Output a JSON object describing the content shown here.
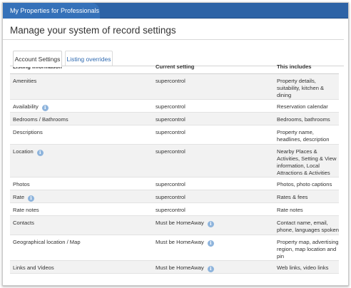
{
  "app": {
    "title": "My Properties for Professionals"
  },
  "page": {
    "title": "Manage your system of record settings"
  },
  "tabs": [
    {
      "label": "Account Settings",
      "active": true
    },
    {
      "label": "Listing overrides",
      "active": false
    }
  ],
  "table": {
    "headers": [
      "Listing information",
      "Current setting",
      "This includes"
    ],
    "rows": [
      {
        "info": "Amenities",
        "info_icon": false,
        "setting": "supercontrol",
        "setting_icon": false,
        "includes": "Property details, suitability, kitchen & dining"
      },
      {
        "info": "Availability",
        "info_icon": true,
        "setting": "supercontrol",
        "setting_icon": false,
        "includes": "Reservation calendar"
      },
      {
        "info": "Bedrooms / Bathrooms",
        "info_icon": false,
        "setting": "supercontrol",
        "setting_icon": false,
        "includes": "Bedrooms, bathrooms"
      },
      {
        "info": "Descriptions",
        "info_icon": false,
        "setting": "supercontrol",
        "setting_icon": false,
        "includes": "Property name, headlines, description"
      },
      {
        "info": "Location",
        "info_icon": true,
        "setting": "supercontrol",
        "setting_icon": false,
        "includes": "Nearby Places & Activities, Setting & View information, Local Attractions & Activities"
      },
      {
        "info": "Photos",
        "info_icon": false,
        "setting": "supercontrol",
        "setting_icon": false,
        "includes": "Photos, photo captions"
      },
      {
        "info": "Rate",
        "info_icon": true,
        "setting": "supercontrol",
        "setting_icon": false,
        "includes": "Rates & fees"
      },
      {
        "info": "Rate notes",
        "info_icon": false,
        "setting": "supercontrol",
        "setting_icon": false,
        "includes": "Rate notes"
      },
      {
        "info": "Contacts",
        "info_icon": false,
        "setting": "Must be HomeAway",
        "setting_icon": true,
        "includes": "Contact name, email, phone, languages spoken"
      },
      {
        "info": "Geographical location / Map",
        "info_icon": false,
        "setting": "Must be HomeAway",
        "setting_icon": true,
        "includes": "Property map, advertising region, map location and pin"
      },
      {
        "info": "Links and Videos",
        "info_icon": false,
        "setting": "Must be HomeAway",
        "setting_icon": true,
        "includes": "Web links, video links"
      }
    ]
  },
  "icons": {
    "info_glyph": "i",
    "info_icon_color": "#8eb4dc",
    "header_color": "#2d63a6"
  }
}
